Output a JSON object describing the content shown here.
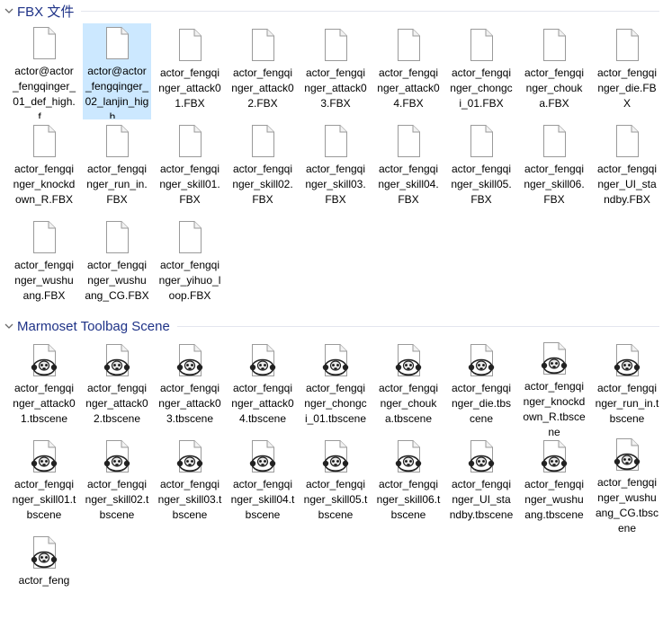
{
  "groups": [
    {
      "title": "FBX 文件",
      "items": [
        {
          "label": "actor@actor_fengqinger_01_def_high.f...",
          "selected": false
        },
        {
          "label": "actor@actor_fengqinger_02_lanjin_high...",
          "selected": true
        },
        {
          "label": "actor_fengqinger_attack01.FBX",
          "selected": false
        },
        {
          "label": "actor_fengqinger_attack02.FBX",
          "selected": false
        },
        {
          "label": "actor_fengqinger_attack03.FBX",
          "selected": false
        },
        {
          "label": "actor_fengqinger_attack04.FBX",
          "selected": false
        },
        {
          "label": "actor_fengqinger_chongci_01.FBX",
          "selected": false
        },
        {
          "label": "actor_fengqinger_chouka.FBX",
          "selected": false
        },
        {
          "label": "actor_fengqinger_die.FBX",
          "selected": false
        },
        {
          "label": "actor_fengqinger_knockdown_R.FBX",
          "selected": false
        },
        {
          "label": "actor_fengqinger_run_in.FBX",
          "selected": false
        },
        {
          "label": "actor_fengqinger_skill01.FBX",
          "selected": false
        },
        {
          "label": "actor_fengqinger_skill02.FBX",
          "selected": false
        },
        {
          "label": "actor_fengqinger_skill03.FBX",
          "selected": false
        },
        {
          "label": "actor_fengqinger_skill04.FBX",
          "selected": false
        },
        {
          "label": "actor_fengqinger_skill05.FBX",
          "selected": false
        },
        {
          "label": "actor_fengqinger_skill06.FBX",
          "selected": false
        },
        {
          "label": "actor_fengqinger_UI_standby.FBX",
          "selected": false
        },
        {
          "label": "actor_fengqinger_wushuang.FBX",
          "selected": false
        },
        {
          "label": "actor_fengqinger_wushuang_CG.FBX",
          "selected": false
        },
        {
          "label": "actor_fengqinger_yihuo_loop.FBX",
          "selected": false
        }
      ]
    },
    {
      "title": "Marmoset Toolbag Scene",
      "items": [
        {
          "label": "actor_fengqinger_attack01.tbscene",
          "selected": false
        },
        {
          "label": "actor_fengqinger_attack02.tbscene",
          "selected": false
        },
        {
          "label": "actor_fengqinger_attack03.tbscene",
          "selected": false
        },
        {
          "label": "actor_fengqinger_attack04.tbscene",
          "selected": false
        },
        {
          "label": "actor_fengqinger_chongci_01.tbscene",
          "selected": false
        },
        {
          "label": "actor_fengqinger_chouka.tbscene",
          "selected": false
        },
        {
          "label": "actor_fengqinger_die.tbscene",
          "selected": false
        },
        {
          "label": "actor_fengqinger_knockdown_R.tbscene",
          "selected": false
        },
        {
          "label": "actor_fengqinger_run_in.tbscene",
          "selected": false
        },
        {
          "label": "actor_fengqinger_skill01.tbscene",
          "selected": false
        },
        {
          "label": "actor_fengqinger_skill02.tbscene",
          "selected": false
        },
        {
          "label": "actor_fengqinger_skill03.tbscene",
          "selected": false
        },
        {
          "label": "actor_fengqinger_skill04.tbscene",
          "selected": false
        },
        {
          "label": "actor_fengqinger_skill05.tbscene",
          "selected": false
        },
        {
          "label": "actor_fengqinger_skill06.tbscene",
          "selected": false
        },
        {
          "label": "actor_fengqinger_UI_standby.tbscene",
          "selected": false
        },
        {
          "label": "actor_fengqinger_wushuang.tbscene",
          "selected": false
        },
        {
          "label": "actor_fengqinger_wushuang_CG.tbscene",
          "selected": false
        },
        {
          "label": "actor_feng",
          "selected": false
        }
      ]
    }
  ],
  "icons": {
    "group_toggle": "chevron-down-icon",
    "fbx_file": "generic-file-icon",
    "tbscene_file": "marmoset-toolbag-icon"
  },
  "colors": {
    "group_title": "#1e3287",
    "selection": "#cce8ff",
    "text": "#000000"
  }
}
